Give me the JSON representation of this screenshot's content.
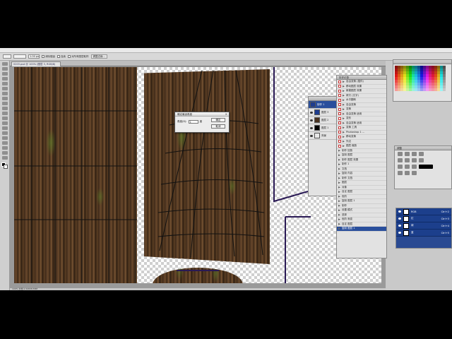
{
  "options_bar": {
    "width_value": "1.00 px",
    "checks": [
      "消除锯齿",
      "连续",
      "对所有图层取样"
    ],
    "refine_button": "调整边缘..."
  },
  "document": {
    "tab_title": "0203.psd @ 100% (图层 3, RGB/8)"
  },
  "dialog": {
    "title": "确定最适角度",
    "field_label": "角度(D):",
    "field_value": "1",
    "unit": "度",
    "ok": "确定",
    "cancel": "取消",
    "close_icon": "×"
  },
  "status": {
    "text": "100%  文档:1.54M/8.58M"
  },
  "history": {
    "title": "历史记录",
    "items": [
      "自由变换 (插件)",
      "移动图层 效果",
      "新建图层 效果",
      "拷贝 (文字)",
      "水平翻转",
      "自由变换",
      "变换",
      "自由变换 适用",
      "变形",
      "自由变换 适用",
      "变换 工具",
      "Photoshop 1 ...",
      "移动变换",
      "外边",
      "图层 缩放"
    ]
  },
  "actions": {
    "items": [
      "制作 回放",
      "复制 图层",
      "制作 图层 效果",
      "制作 1",
      "文档",
      "复制 内容",
      "制作 文档",
      "图层",
      "对象",
      "自定 图层",
      "色阶",
      "复制 图层 1",
      "制作",
      "设置 模式",
      "选择",
      "色阶 渐变",
      "自定 图层",
      "复制 图层 1"
    ],
    "selected_label": "制作 1"
  },
  "layers": {
    "title": "图层",
    "selected_name": "图层 3",
    "items": [
      {
        "name": "图层 3",
        "thumb_color": "#1d3c8f"
      },
      {
        "name": "图层 2",
        "thumb_color": "#4a3320"
      },
      {
        "name": "图层 1",
        "thumb_color": "#000000"
      },
      {
        "name": "背景",
        "thumb_color": "#e8e8e8"
      }
    ]
  },
  "channels": {
    "items": [
      {
        "name": "RGB",
        "key": "Ctrl+2"
      },
      {
        "name": "红",
        "key": "Ctrl+3"
      },
      {
        "name": "绿",
        "key": "Ctrl+4"
      },
      {
        "name": "蓝",
        "key": "Ctrl+5"
      }
    ]
  },
  "adjustments": {
    "title": "调整"
  },
  "colors": {
    "accent": "#2a4f9c",
    "channel_bg": "#1c3f8c"
  }
}
